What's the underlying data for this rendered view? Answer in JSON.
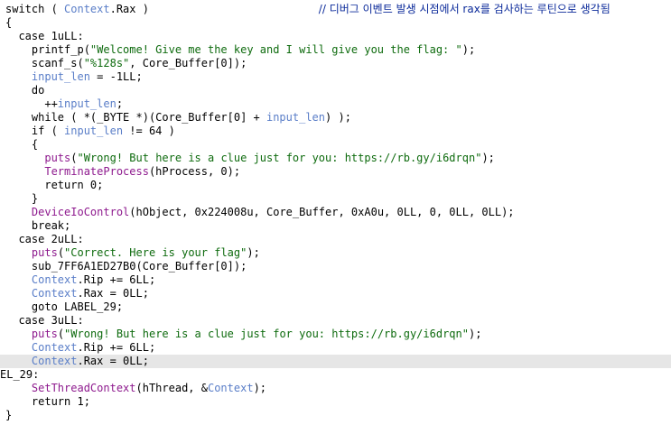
{
  "code": {
    "highlighted_line": 26,
    "lines": [
      [
        {
          "t": "switch ( ",
          "c": "plain"
        },
        {
          "t": "Context",
          "c": "var"
        },
        {
          "t": ".Rax )                          ",
          "c": "plain"
        },
        {
          "t": "// 디버그 이벤트 발생 시점에서 rax를 검사하는 루틴으로 생각됨",
          "c": "comment"
        }
      ],
      [
        {
          "t": "{",
          "c": "plain"
        }
      ],
      [
        {
          "t": "  case 1uLL:",
          "c": "plain"
        }
      ],
      [
        {
          "t": "    printf_p(",
          "c": "plain"
        },
        {
          "t": "\"Welcome! Give me the key and I will give you the flag: \"",
          "c": "str"
        },
        {
          "t": ");",
          "c": "plain"
        }
      ],
      [
        {
          "t": "    scanf_s(",
          "c": "plain"
        },
        {
          "t": "\"%128s\"",
          "c": "str"
        },
        {
          "t": ", Core_Buffer[0]);",
          "c": "plain"
        }
      ],
      [
        {
          "t": "    ",
          "c": "plain"
        },
        {
          "t": "input_len",
          "c": "var"
        },
        {
          "t": " = -1LL;",
          "c": "plain"
        }
      ],
      [
        {
          "t": "    do",
          "c": "plain"
        }
      ],
      [
        {
          "t": "      ++",
          "c": "plain"
        },
        {
          "t": "input_len",
          "c": "var"
        },
        {
          "t": ";",
          "c": "plain"
        }
      ],
      [
        {
          "t": "    while ( *(_BYTE *)(Core_Buffer[0] + ",
          "c": "plain"
        },
        {
          "t": "input_len",
          "c": "var"
        },
        {
          "t": ") );",
          "c": "plain"
        }
      ],
      [
        {
          "t": "    if ( ",
          "c": "plain"
        },
        {
          "t": "input_len",
          "c": "var"
        },
        {
          "t": " != 64 )",
          "c": "plain"
        }
      ],
      [
        {
          "t": "    {",
          "c": "plain"
        }
      ],
      [
        {
          "t": "      ",
          "c": "plain"
        },
        {
          "t": "puts",
          "c": "func"
        },
        {
          "t": "(",
          "c": "plain"
        },
        {
          "t": "\"Wrong! But here is a clue just for you: https://rb.gy/i6drqn\"",
          "c": "str"
        },
        {
          "t": ");",
          "c": "plain"
        }
      ],
      [
        {
          "t": "      ",
          "c": "plain"
        },
        {
          "t": "TerminateProcess",
          "c": "func"
        },
        {
          "t": "(hProcess, 0);",
          "c": "plain"
        }
      ],
      [
        {
          "t": "      return 0;",
          "c": "plain"
        }
      ],
      [
        {
          "t": "    }",
          "c": "plain"
        }
      ],
      [
        {
          "t": "    ",
          "c": "plain"
        },
        {
          "t": "DeviceIoControl",
          "c": "func"
        },
        {
          "t": "(hObject, 0x224008u, Core_Buffer, 0xA0u, 0LL, 0, 0LL, 0LL);",
          "c": "plain"
        }
      ],
      [
        {
          "t": "    break;",
          "c": "plain"
        }
      ],
      [
        {
          "t": "  case 2uLL:",
          "c": "plain"
        }
      ],
      [
        {
          "t": "    ",
          "c": "plain"
        },
        {
          "t": "puts",
          "c": "func"
        },
        {
          "t": "(",
          "c": "plain"
        },
        {
          "t": "\"Correct. Here is your flag\"",
          "c": "str"
        },
        {
          "t": ");",
          "c": "plain"
        }
      ],
      [
        {
          "t": "    sub_7FF6A1ED27B0(Core_Buffer[0]);",
          "c": "plain"
        }
      ],
      [
        {
          "t": "    ",
          "c": "plain"
        },
        {
          "t": "Context",
          "c": "var"
        },
        {
          "t": ".Rip += 6LL;",
          "c": "plain"
        }
      ],
      [
        {
          "t": "    ",
          "c": "plain"
        },
        {
          "t": "Context",
          "c": "var"
        },
        {
          "t": ".Rax = 0LL;",
          "c": "plain"
        }
      ],
      [
        {
          "t": "    goto LABEL_29;",
          "c": "plain"
        }
      ],
      [
        {
          "t": "  case 3uLL:",
          "c": "plain"
        }
      ],
      [
        {
          "t": "    ",
          "c": "plain"
        },
        {
          "t": "puts",
          "c": "func"
        },
        {
          "t": "(",
          "c": "plain"
        },
        {
          "t": "\"Wrong! But here is a clue just for you: https://rb.gy/i6drqn\"",
          "c": "str"
        },
        {
          "t": ");",
          "c": "plain"
        }
      ],
      [
        {
          "t": "    ",
          "c": "plain"
        },
        {
          "t": "Context",
          "c": "var"
        },
        {
          "t": ".Rip += 6LL;",
          "c": "plain"
        }
      ],
      [
        {
          "t": "    ",
          "c": "plain"
        },
        {
          "t": "Context",
          "c": "var"
        },
        {
          "t": ".Rax = 0LL;",
          "c": "plain"
        }
      ],
      [
        {
          "t": "EL_29:",
          "c": "plain"
        }
      ],
      [
        {
          "t": "    ",
          "c": "plain"
        },
        {
          "t": "SetThreadContext",
          "c": "func"
        },
        {
          "t": "(hThread, &",
          "c": "plain"
        },
        {
          "t": "Context",
          "c": "var"
        },
        {
          "t": ");",
          "c": "plain"
        }
      ],
      [
        {
          "t": "    return 1;",
          "c": "plain"
        }
      ],
      [
        {
          "t": "}",
          "c": "plain"
        }
      ]
    ]
  }
}
